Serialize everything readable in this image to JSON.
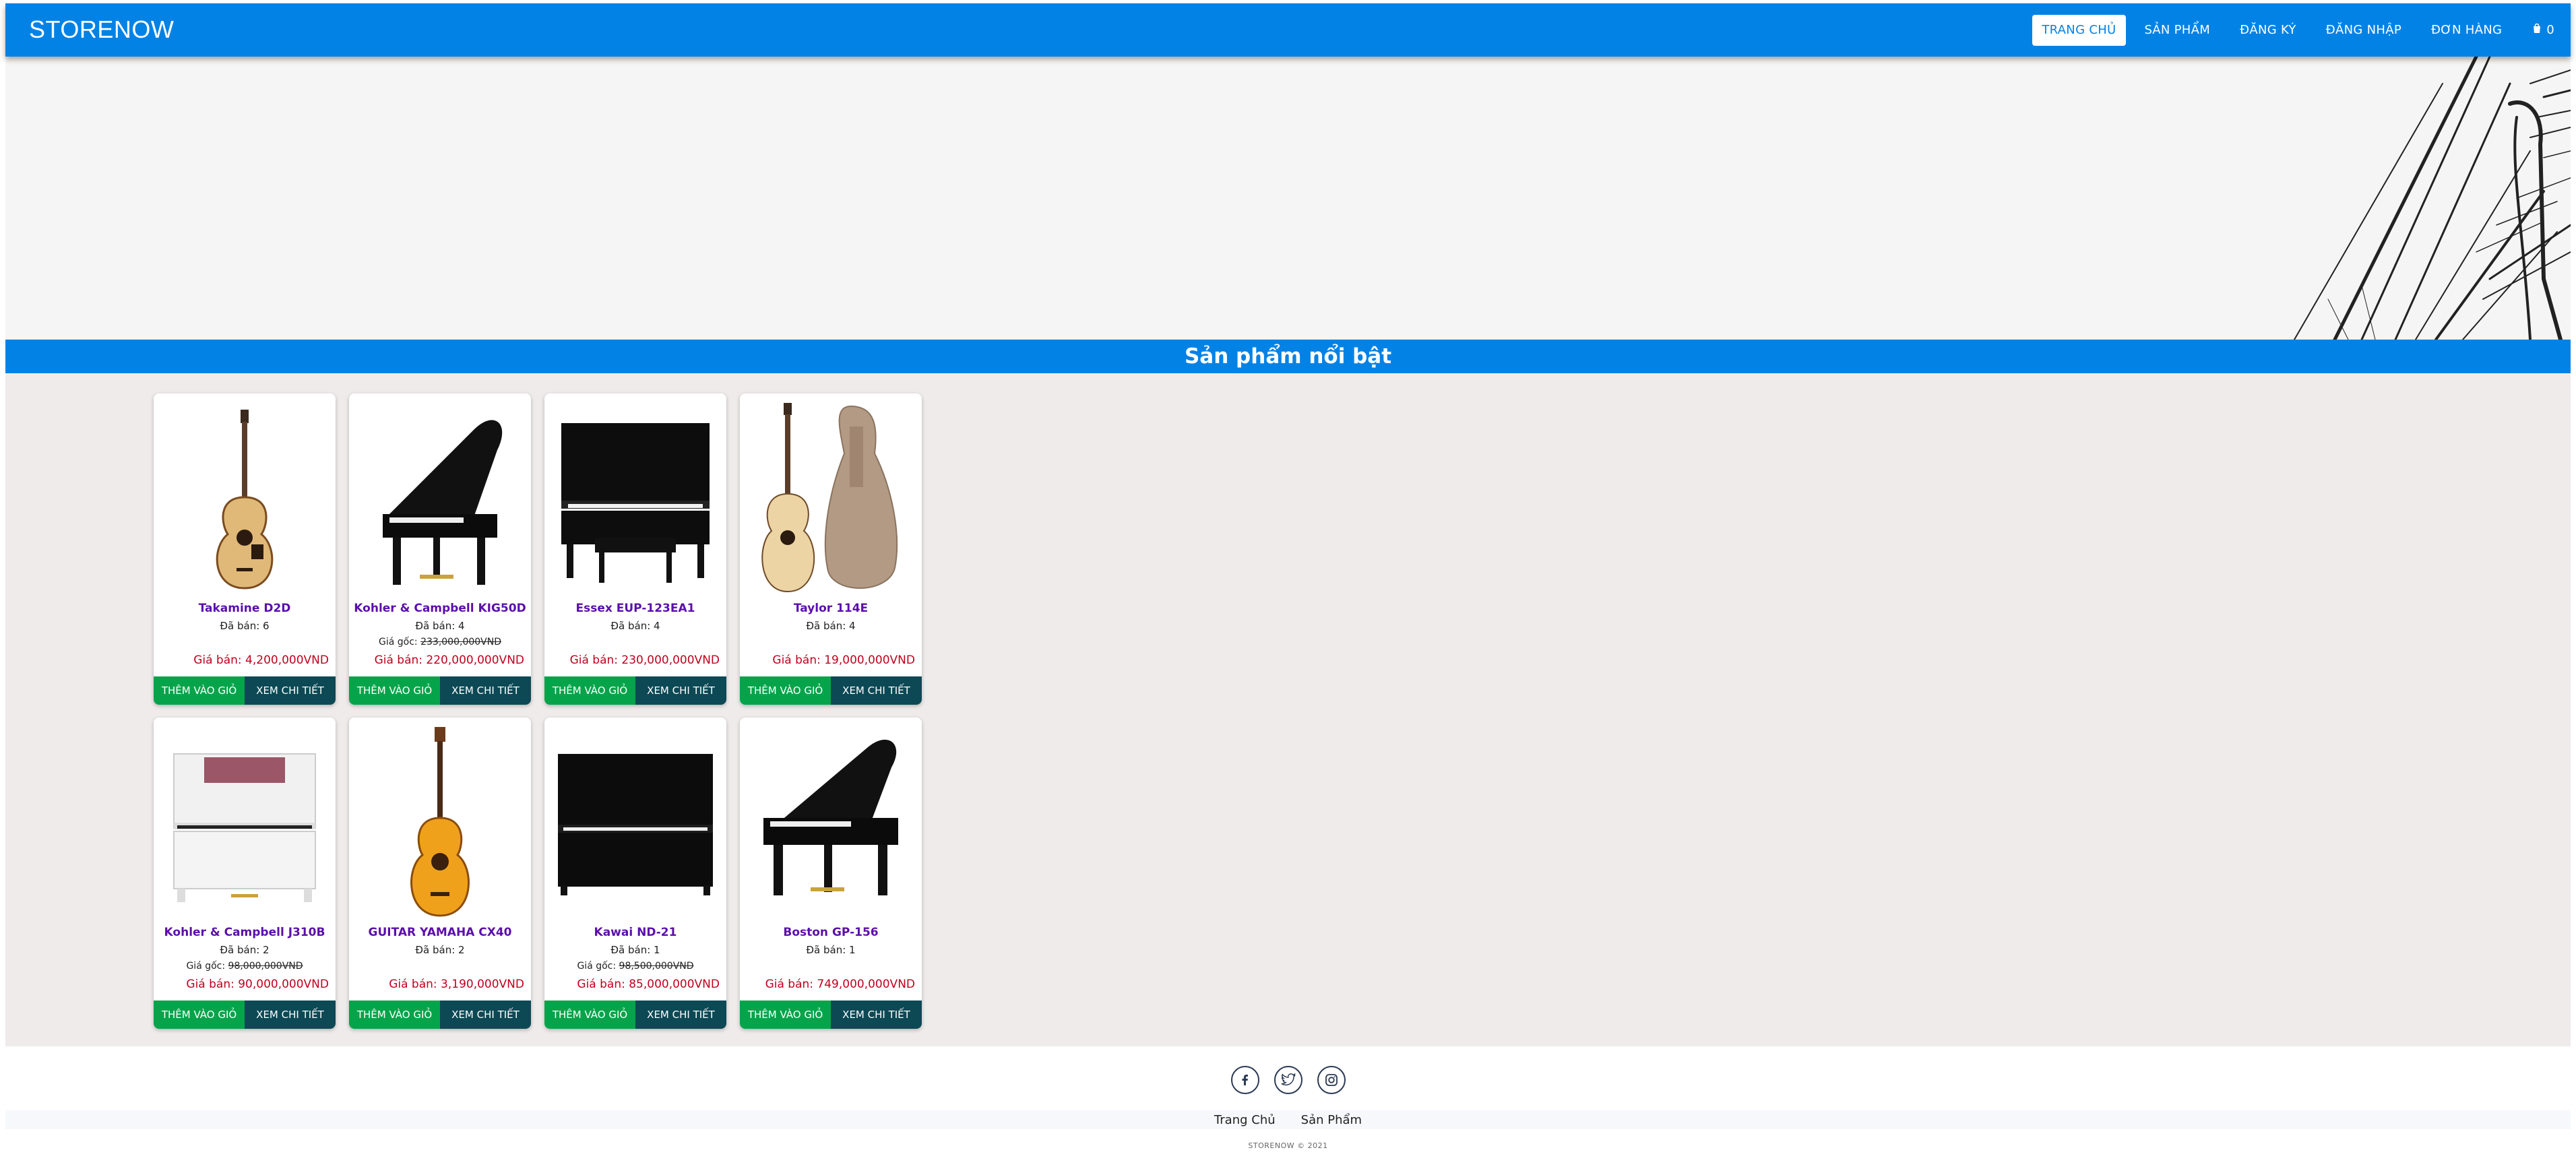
{
  "navbar": {
    "brand": "STORENOW",
    "items": [
      {
        "label": "TRANG CHỦ"
      },
      {
        "label": "SẢN PHẨM"
      },
      {
        "label": "ĐĂNG KÝ"
      },
      {
        "label": "ĐĂNG NHẬP"
      },
      {
        "label": "ĐƠN HÀNG"
      }
    ],
    "cart_count": "0"
  },
  "section": {
    "title": "Sản phẩm nổi bật"
  },
  "products": [
    {
      "name": "Takamine D2D",
      "sold": "Đã bán: 6",
      "orig_label": "",
      "orig": "",
      "price": "Giá bán: 4,200,000VND",
      "image": "acoustic-guitar-icon"
    },
    {
      "name": "Kohler & Campbell KIG50D",
      "sold": "Đã bán: 4",
      "orig_label": "Giá gốc:",
      "orig": "233,000,000VND",
      "price": "Giá bán: 220,000,000VND",
      "image": "grand-piano-icon"
    },
    {
      "name": "Essex EUP-123EA1",
      "sold": "Đã bán: 4",
      "orig_label": "",
      "orig": "",
      "price": "Giá bán: 230,000,000VND",
      "image": "upright-piano-icon"
    },
    {
      "name": "Taylor 114E",
      "sold": "Đã bán: 4",
      "orig_label": "",
      "orig": "",
      "price": "Giá bán: 19,000,000VND",
      "image": "guitar-with-case-icon"
    },
    {
      "name": "Kohler & Campbell J310B",
      "sold": "Đã bán: 2",
      "orig_label": "Giá gốc:",
      "orig": "98,000,000VND",
      "price": "Giá bán: 90,000,000VND",
      "image": "white-upright-piano-icon"
    },
    {
      "name": "GUITAR YAMAHA CX40",
      "sold": "Đã bán: 2",
      "orig_label": "",
      "orig": "",
      "price": "Giá bán: 3,190,000VND",
      "image": "classical-guitar-icon"
    },
    {
      "name": "Kawai ND-21",
      "sold": "Đã bán: 1",
      "orig_label": "Giá gốc:",
      "orig": "98,500,000VND",
      "price": "Giá bán: 85,000,000VND",
      "image": "black-upright-piano-icon"
    },
    {
      "name": "Boston GP-156",
      "sold": "Đã bán: 1",
      "orig_label": "",
      "orig": "",
      "price": "Giá bán: 749,000,000VND",
      "image": "grand-piano-icon"
    }
  ],
  "buttons": {
    "add_to_cart": "THÊM VÀO GIỎ",
    "view_detail": "XEM CHI TIẾT"
  },
  "footer": {
    "social": [
      "facebook-icon",
      "twitter-icon",
      "instagram-icon"
    ],
    "links": [
      "Trang Chủ",
      "Sản Phẩm"
    ],
    "copyright": "STORENOW © 2021"
  },
  "colors": {
    "primary": "#0382e6",
    "add_button": "#06a44a",
    "detail_button": "#0c4955",
    "product_name": "#5b0eab",
    "price": "#c0001d"
  }
}
